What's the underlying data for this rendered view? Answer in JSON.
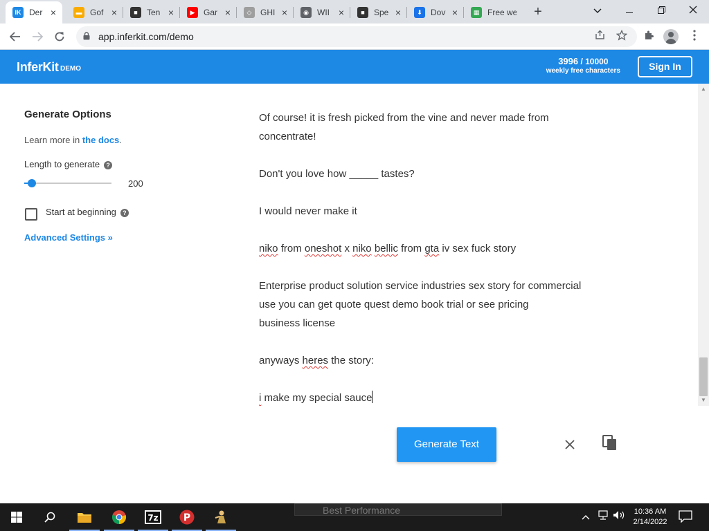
{
  "browser": {
    "tabs": [
      {
        "title": "Der",
        "favicon": "inferkit-logo",
        "color": "#1e88e5",
        "active": true
      },
      {
        "title": "Gof",
        "favicon": "folder-icon",
        "color": "#f9ab00",
        "active": false
      },
      {
        "title": "Ten",
        "favicon": "camera-icon",
        "color": "#333333",
        "active": false
      },
      {
        "title": "Gar",
        "favicon": "youtube-icon",
        "color": "#ff0000",
        "active": false
      },
      {
        "title": "GHI",
        "favicon": "diamond-icon",
        "color": "#9e9e9e",
        "active": false
      },
      {
        "title": "WII",
        "favicon": "globe-icon",
        "color": "#5f6368",
        "active": false
      },
      {
        "title": "Spe",
        "favicon": "camera-icon",
        "color": "#333333",
        "active": false
      },
      {
        "title": "Dov",
        "favicon": "download-icon",
        "color": "#1a73e8",
        "active": false
      },
      {
        "title": "Free we",
        "favicon": "sheets-icon",
        "color": "#34a853",
        "active": false
      }
    ],
    "url": "app.inferkit.com/demo"
  },
  "header": {
    "logo": "InferKit",
    "logo_suffix": "DEMO",
    "chars_remaining": "3996",
    "chars_total": "/ 10000",
    "chars_caption": "weekly free characters",
    "sign_in": "Sign In"
  },
  "options": {
    "title": "Generate Options",
    "learn_prefix": "Learn more in ",
    "learn_link": "the docs",
    "learn_suffix": ".",
    "length_label": "Length to generate",
    "length_value": "200",
    "length_fraction": 0.09,
    "start_label": "Start at beginning",
    "start_checked": false,
    "advanced": "Advanced Settings »"
  },
  "editor": {
    "paragraphs": [
      [
        "Of course! it is fresh picked from the vine and never made from",
        "concentrate!"
      ],
      [
        "Don't you love how _____ tastes?"
      ],
      [
        "I would never make it"
      ],
      [
        "niko from oneshot x niko bellic from gta iv sex fuck story"
      ],
      [
        "Enterprise product solution service industries sex story for commercial",
        "use you can get quote quest demo book trial or see pricing",
        "business license"
      ],
      [
        "anyways heres the story:"
      ],
      [
        "i make my special sauce"
      ]
    ]
  },
  "actions": {
    "generate": "Generate Text"
  },
  "taskbar": {
    "ghost_text": "Best Performance",
    "time": "10:36 AM",
    "date": "2/14/2022",
    "apps": [
      "file-explorer-icon",
      "chrome-icon",
      "7zip-icon",
      "p-app-icon",
      "figure-icon"
    ]
  }
}
